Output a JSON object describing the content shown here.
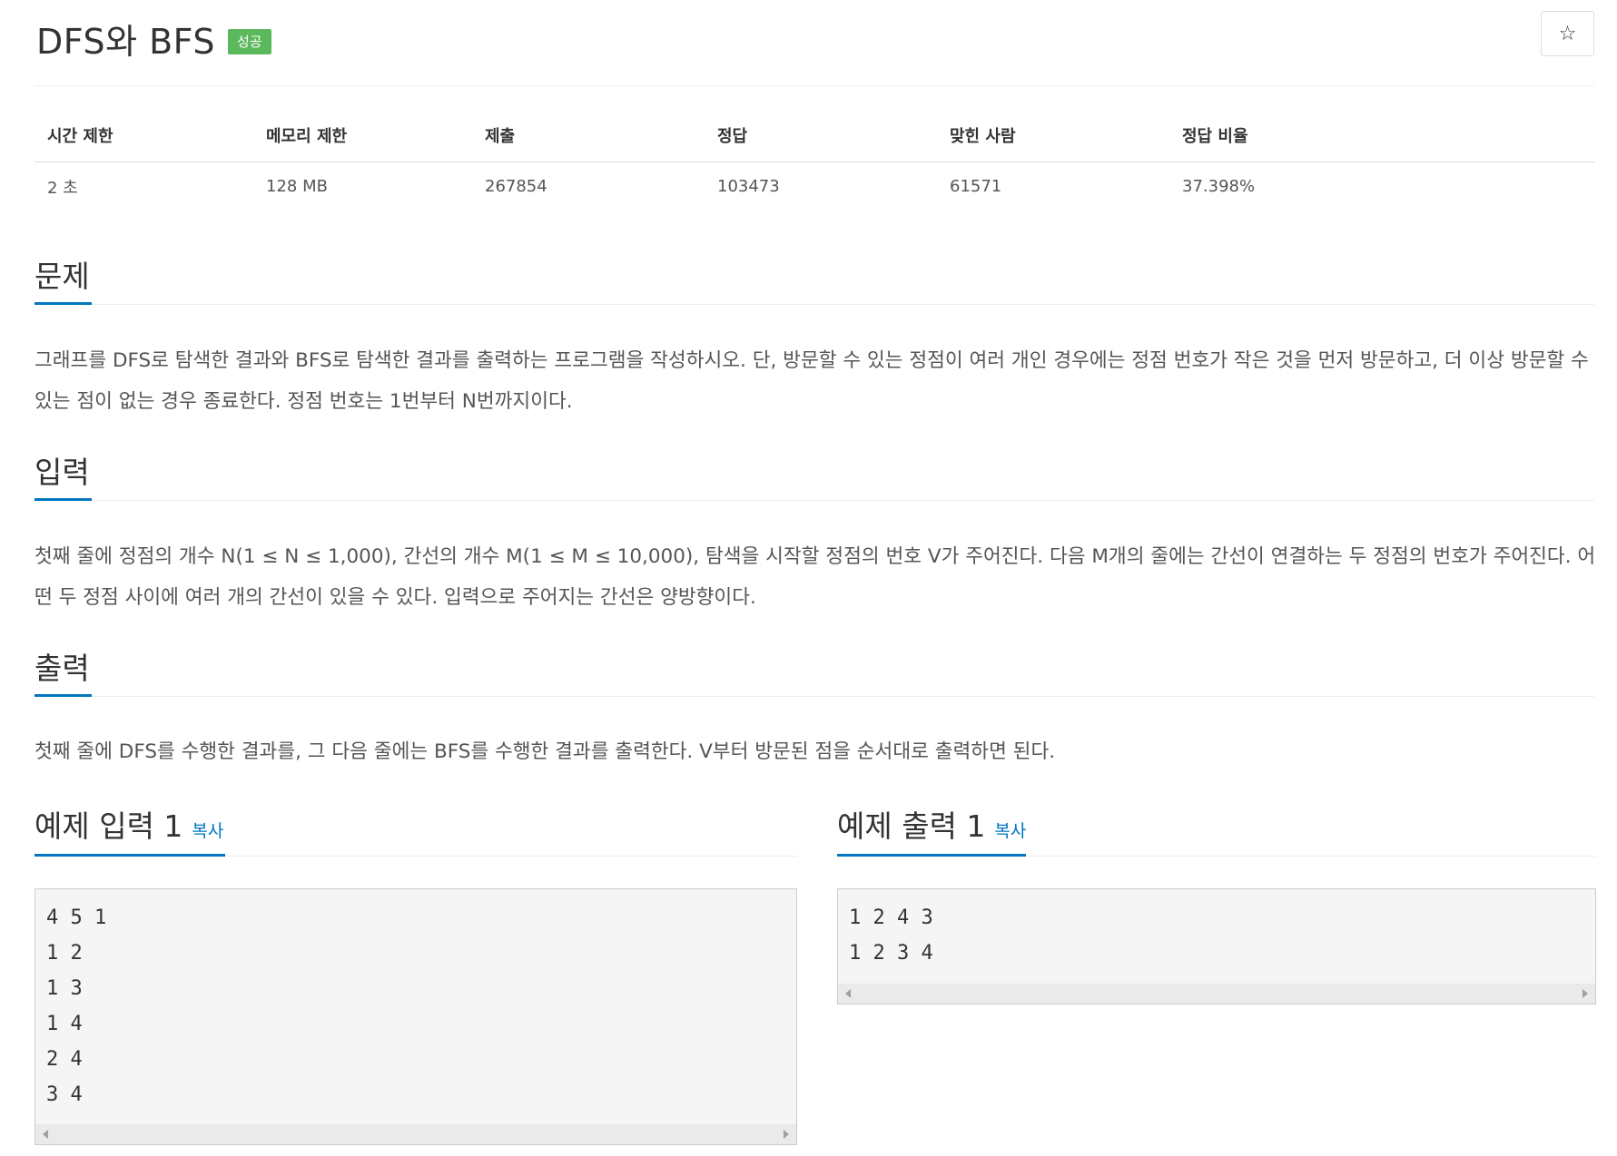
{
  "problem": {
    "title": "DFS와 BFS",
    "status_badge": "성공",
    "star_icon": "☆"
  },
  "info_table": {
    "headers": [
      "시간 제한",
      "메모리 제한",
      "제출",
      "정답",
      "맞힌 사람",
      "정답 비율"
    ],
    "values": [
      "2 초",
      "128 MB",
      "267854",
      "103473",
      "61571",
      "37.398%"
    ]
  },
  "sections": {
    "problem": {
      "heading": "문제",
      "text": "그래프를 DFS로 탐색한 결과와 BFS로 탐색한 결과를 출력하는 프로그램을 작성하시오. 단, 방문할 수 있는 정점이 여러 개인 경우에는 정점 번호가 작은 것을 먼저 방문하고, 더 이상 방문할 수 있는 점이 없는 경우 종료한다. 정점 번호는 1번부터 N번까지이다."
    },
    "input": {
      "heading": "입력",
      "text": "첫째 줄에 정점의 개수 N(1 ≤ N ≤ 1,000), 간선의 개수 M(1 ≤ M ≤ 10,000), 탐색을 시작할 정점의 번호 V가 주어진다. 다음 M개의 줄에는 간선이 연결하는 두 정점의 번호가 주어진다. 어떤 두 정점 사이에 여러 개의 간선이 있을 수 있다. 입력으로 주어지는 간선은 양방향이다."
    },
    "output": {
      "heading": "출력",
      "text": "첫째 줄에 DFS를 수행한 결과를, 그 다음 줄에는 BFS를 수행한 결과를 출력한다. V부터 방문된 점을 순서대로 출력하면 된다."
    }
  },
  "examples": {
    "input": {
      "heading": "예제 입력 1",
      "copy_label": "복사",
      "content": "4 5 1\n1 2\n1 3\n1 4\n2 4\n3 4"
    },
    "output": {
      "heading": "예제 출력 1",
      "copy_label": "복사",
      "content": "1 2 4 3\n1 2 3 4"
    }
  },
  "colors": {
    "accent": "#0076c0",
    "success": "#5cb85c",
    "text": "#555555",
    "heading": "#333333",
    "code_bg": "#f5f5f5"
  }
}
